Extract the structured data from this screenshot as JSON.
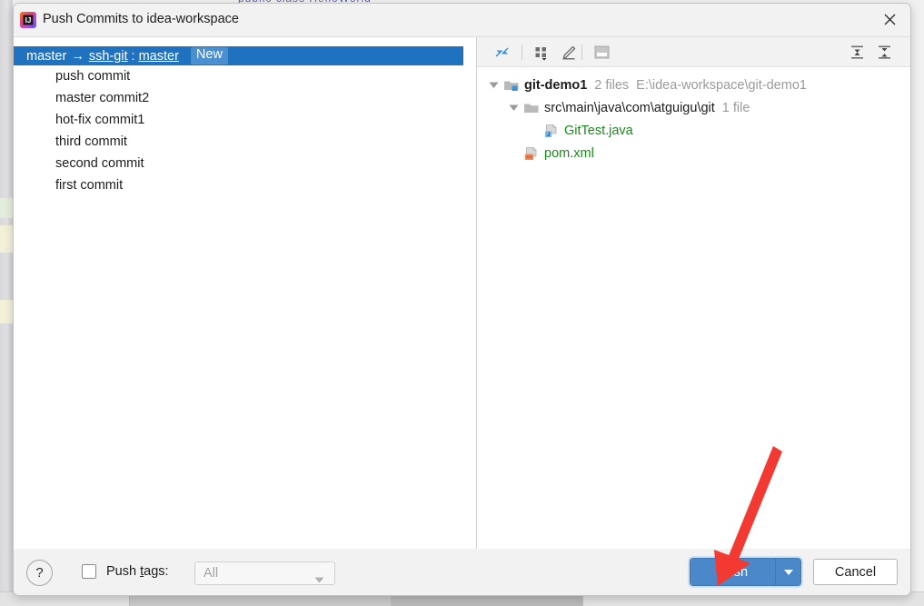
{
  "window": {
    "title": "Push Commits to idea-workspace",
    "app_icon": "intellij-idea-icon",
    "close_icon": "close-icon"
  },
  "commit_panel": {
    "branch_row": {
      "source_branch": "master",
      "arrow": "→",
      "remote": "ssh-git",
      "separator": ":",
      "target_branch": "master",
      "badge": "New"
    },
    "commits": [
      {
        "message": "push commit"
      },
      {
        "message": "master commit2"
      },
      {
        "message": "hot-fix commit1"
      },
      {
        "message": "third commit"
      },
      {
        "message": "second commit"
      },
      {
        "message": "first commit"
      }
    ]
  },
  "changes_panel": {
    "toolbar": {
      "left_buttons": [
        {
          "name": "collapse-arrows-icon",
          "tooltip": "Collapse"
        },
        {
          "name": "group-by-icon",
          "tooltip": "Group By"
        },
        {
          "name": "edit-pencil-icon",
          "tooltip": "Edit Source"
        },
        {
          "name": "preview-pane-icon",
          "tooltip": "Preview Diff"
        }
      ],
      "right_buttons": [
        {
          "name": "expand-all-icon",
          "tooltip": "Expand All"
        },
        {
          "name": "collapse-all-icon",
          "tooltip": "Collapse All"
        }
      ]
    },
    "tree": [
      {
        "icon": "module-folder-icon",
        "name": "git-demo1",
        "bold": true,
        "added": false,
        "meta": "2 files",
        "meta2": "E:\\idea-workspace\\git-demo1",
        "indent": 0,
        "expanded": true
      },
      {
        "icon": "folder-icon",
        "name": "src\\main\\java\\com\\atguigu\\git",
        "bold": false,
        "added": false,
        "meta": "1 file",
        "meta2": "",
        "indent": 1,
        "expanded": true
      },
      {
        "icon": "java-file-icon",
        "name": "GitTest.java",
        "bold": false,
        "added": true,
        "meta": "",
        "meta2": "",
        "indent": 2,
        "expanded": null
      },
      {
        "icon": "xml-file-icon",
        "name": "pom.xml",
        "bold": false,
        "added": true,
        "meta": "",
        "meta2": "",
        "indent": 1,
        "expanded": null
      }
    ]
  },
  "bottom_bar": {
    "help_label": "?",
    "push_tags_checked": false,
    "push_tags_label_pre": "Push ",
    "push_tags_label_mnemonic": "t",
    "push_tags_label_post": "ags:",
    "tags_value": "All",
    "push_label_pre": "",
    "push_label_mnemonic": "P",
    "push_label_post": "ush",
    "push_dropdown_icon": "chevron-down-icon",
    "cancel_label": "Cancel"
  },
  "annotation": {
    "arrow_color": "#f33a32",
    "points_to": "push-button"
  },
  "colors": {
    "selection_blue": "#1f72c0",
    "badge_blue": "#4a8fd0",
    "button_blue": "#4a88c9",
    "added_green": "#1a8a1a",
    "meta_gray": "#9a9a9a",
    "dialog_bg": "#f2f2f2"
  }
}
